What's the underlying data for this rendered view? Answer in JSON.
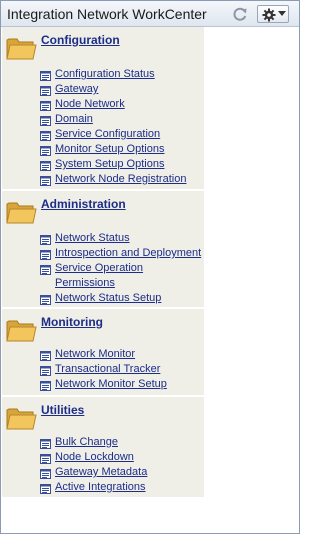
{
  "header": {
    "title": "Integration Network WorkCenter"
  },
  "icons": {
    "refresh": "refresh-icon",
    "settings": "gear-icon",
    "menu_arrow": "chevron-down-icon",
    "folder": "folder-icon",
    "link": "page-icon"
  },
  "colors": {
    "link": "#1c2d8a",
    "panel_background": "#efefe7",
    "folder": "#f2c65c"
  },
  "sections": [
    {
      "title": "Configuration",
      "links": [
        "Configuration Status",
        "Gateway",
        "Node Network",
        "Domain",
        "Service Configuration",
        "Monitor Setup Options",
        "System Setup Options",
        "Network Node Registration"
      ]
    },
    {
      "title": "Administration",
      "links": [
        "Network Status",
        "Introspection and Deployment",
        "Service Operation Permissions",
        "Network Status Setup"
      ]
    },
    {
      "title": "Monitoring",
      "links": [
        "Network Monitor",
        "Transactional Tracker",
        "Network Monitor Setup"
      ]
    },
    {
      "title": "Utilities",
      "links": [
        "Bulk Change",
        "Node Lockdown",
        "Gateway Metadata",
        "Active Integrations"
      ]
    }
  ]
}
